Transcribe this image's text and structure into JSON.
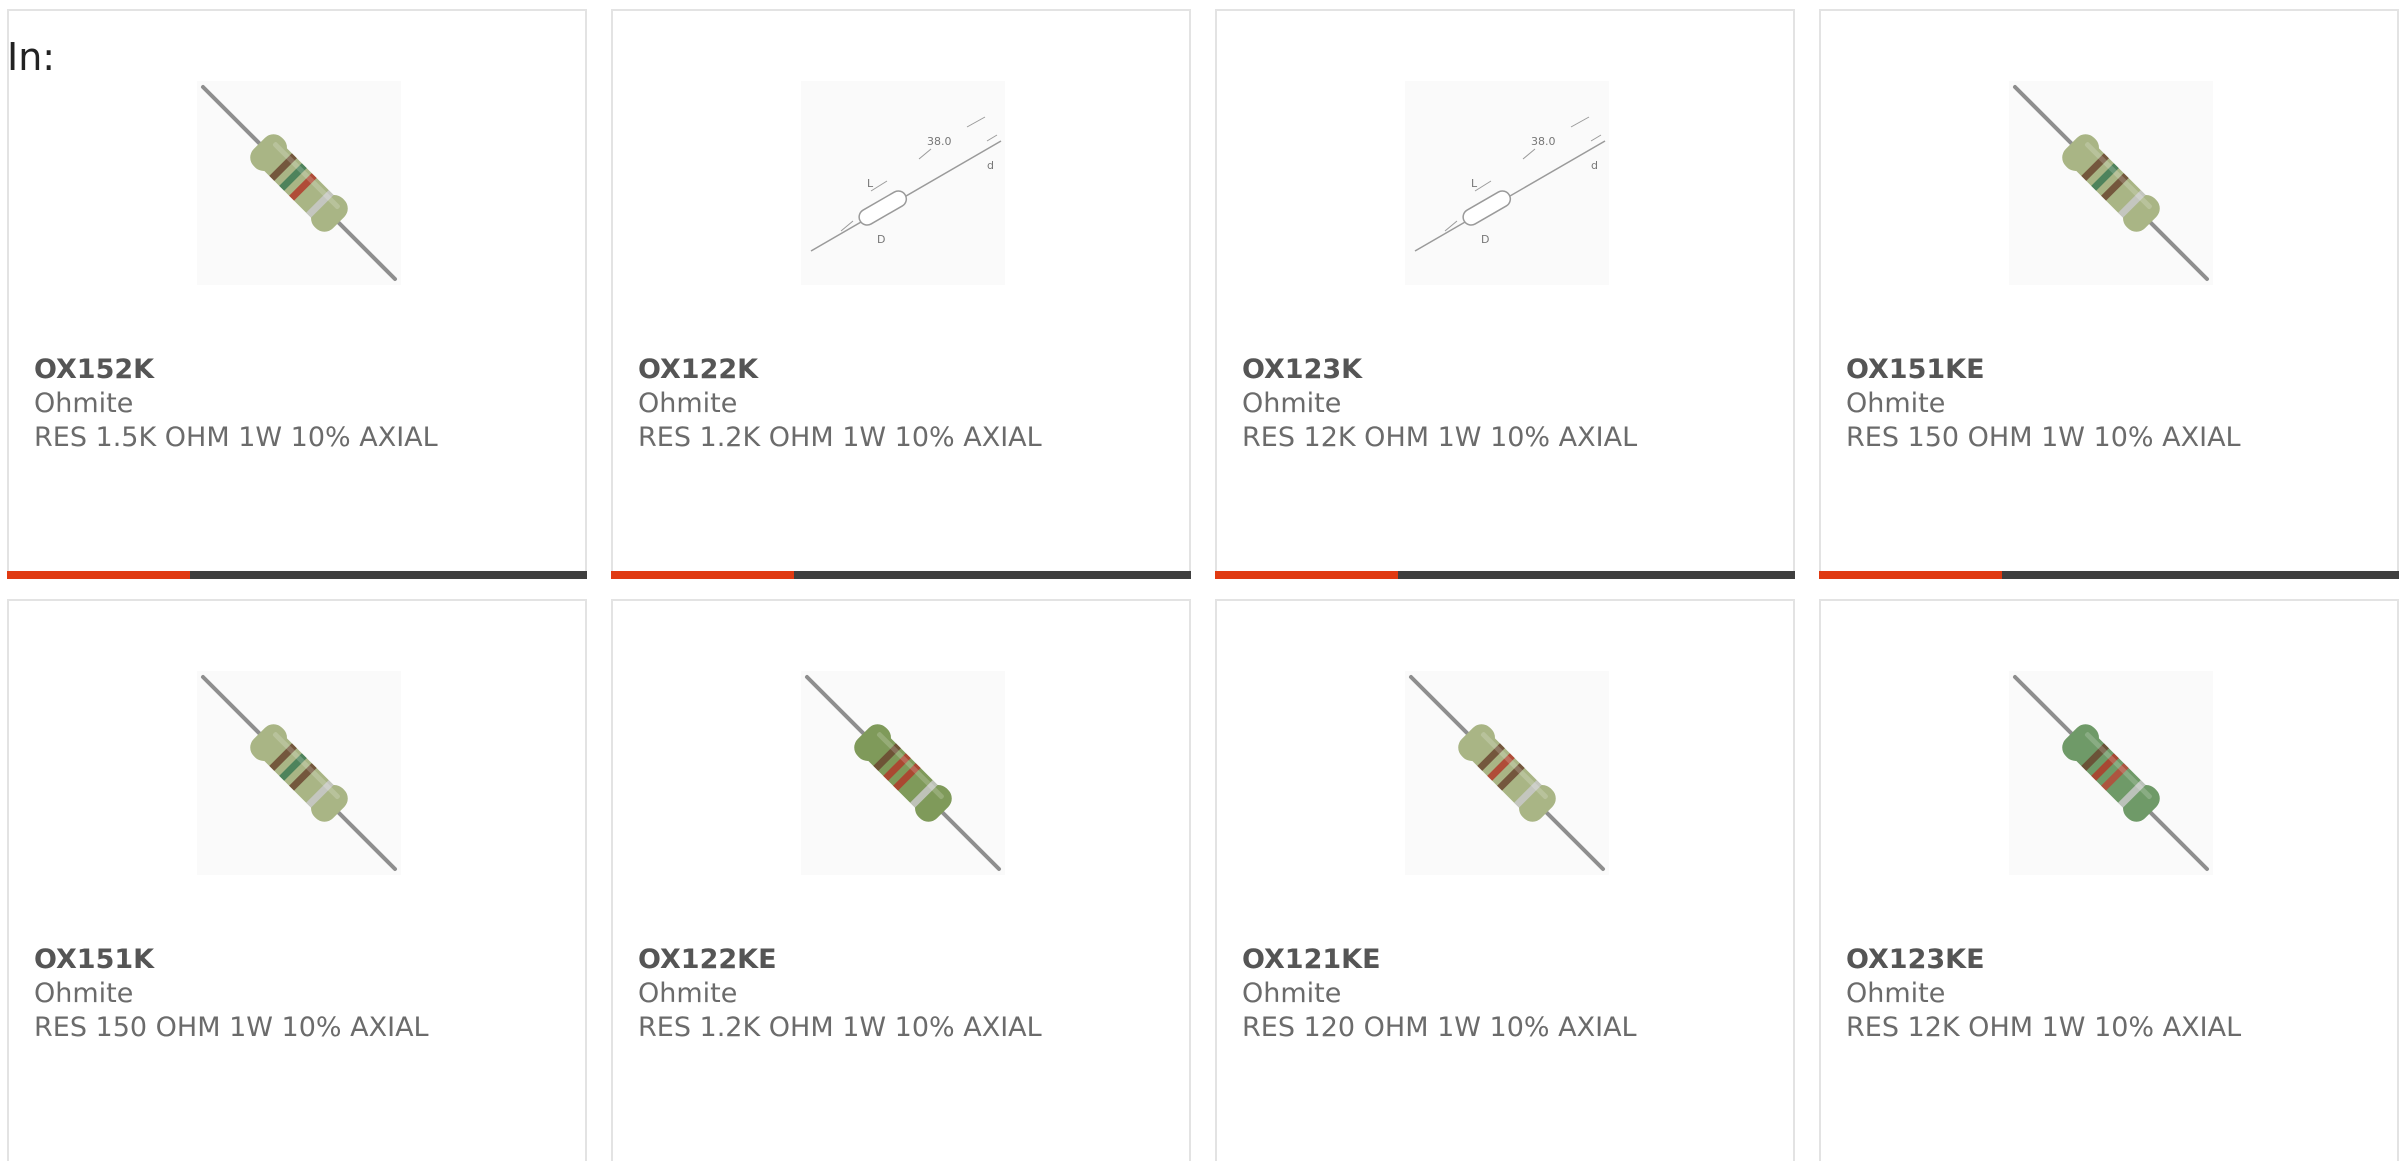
{
  "filter_label": "In:",
  "colors": {
    "accent": "#e03a12",
    "bar": "#3f3f3f",
    "border": "#e3e3e3",
    "text": "#6b6b6b"
  },
  "products": [
    {
      "part_number": "OX152K",
      "manufacturer": "Ohmite",
      "description": "RES 1.5K OHM 1W 10% AXIAL",
      "image": "resistor-photo-icon",
      "bands": [
        "#6b4630",
        "#3e7a55",
        "#b23a2a",
        "#c9c9c9"
      ],
      "body": "#a9b585"
    },
    {
      "part_number": "OX122K",
      "manufacturer": "Ohmite",
      "description": "RES 1.2K OHM 1W 10% AXIAL",
      "image": "resistor-dimension-drawing-icon",
      "dim_label": "38.0",
      "dim_l": "L",
      "dim_d": "D",
      "dim_lead": "d"
    },
    {
      "part_number": "OX123K",
      "manufacturer": "Ohmite",
      "description": "RES 12K OHM 1W 10% AXIAL",
      "image": "resistor-dimension-drawing-icon",
      "dim_label": "38.0",
      "dim_l": "L",
      "dim_d": "D",
      "dim_lead": "d"
    },
    {
      "part_number": "OX151KE",
      "manufacturer": "Ohmite",
      "description": "RES 150 OHM 1W 10% AXIAL",
      "image": "resistor-photo-icon",
      "bands": [
        "#6b4630",
        "#3e7a55",
        "#6b4630",
        "#c9c9c9"
      ],
      "body": "#a9b585"
    },
    {
      "part_number": "OX151K",
      "manufacturer": "Ohmite",
      "description": "RES 150 OHM 1W 10% AXIAL",
      "image": "resistor-photo-icon",
      "bands": [
        "#6b4630",
        "#3e7a55",
        "#6b4630",
        "#c9c9c9"
      ],
      "body": "#a9b585"
    },
    {
      "part_number": "OX122KE",
      "manufacturer": "Ohmite",
      "description": "RES 1.2K OHM 1W 10% AXIAL",
      "image": "resistor-photo-icon",
      "bands": [
        "#6b4630",
        "#b23a2a",
        "#b23a2a",
        "#c9c9c9"
      ],
      "body": "#7f9a5a"
    },
    {
      "part_number": "OX121KE",
      "manufacturer": "Ohmite",
      "description": "RES 120 OHM 1W 10% AXIAL",
      "image": "resistor-photo-icon",
      "bands": [
        "#6b4630",
        "#b23a2a",
        "#6b4630",
        "#c9c9c9"
      ],
      "body": "#a9b585"
    },
    {
      "part_number": "OX123KE",
      "manufacturer": "Ohmite",
      "description": "RES 12K OHM 1W 10% AXIAL",
      "image": "resistor-photo-icon",
      "bands": [
        "#6b4630",
        "#b23a2a",
        "#b8493a",
        "#c9c9c9"
      ],
      "body": "#6f9a68"
    }
  ]
}
